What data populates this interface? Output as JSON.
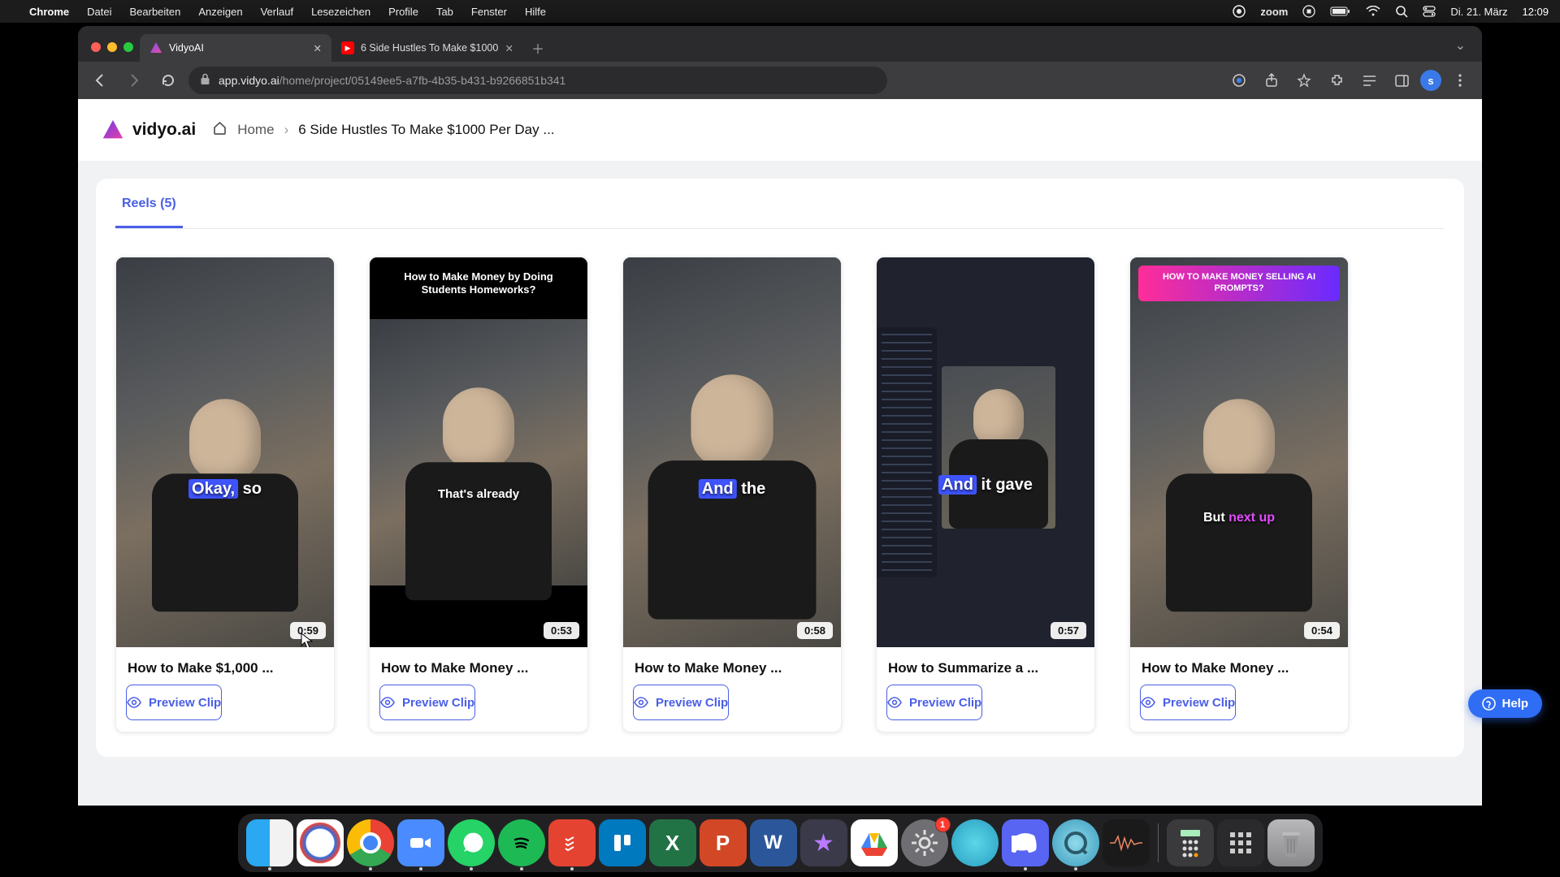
{
  "menubar": {
    "app": "Chrome",
    "items": [
      "Datei",
      "Bearbeiten",
      "Anzeigen",
      "Verlauf",
      "Lesezeichen",
      "Profile",
      "Tab",
      "Fenster",
      "Hilfe"
    ],
    "zoom": "zoom",
    "date": "Di. 21. März",
    "time": "12:09"
  },
  "browser": {
    "tabs": [
      {
        "title": "VidyoAI",
        "active": true
      },
      {
        "title": "6 Side Hustles To Make $1000",
        "active": false
      }
    ],
    "url_host": "app.vidyo.ai",
    "url_path": "/home/project/05149ee5-a7fb-4b35-b431-b9266851b341",
    "profile_initial": "s"
  },
  "page": {
    "brand": "vidyo.ai",
    "breadcrumb": {
      "home": "Home",
      "current": "6 Side Hustles To Make $1000 Per Day ..."
    },
    "tab_label": "Reels (5)",
    "preview_label": "Preview Clip",
    "help_label": "Help",
    "reels": [
      {
        "title": "How to Make $1,000 ...",
        "duration": "0:59",
        "caption_hl": "Okay,",
        "caption_rest": " so",
        "style": "blue"
      },
      {
        "title": "How to Make Money ...",
        "duration": "0:53",
        "banner": "How to Make Money by Doing Students Homeworks?",
        "caption_line": "That's already",
        "style": "blackbanner"
      },
      {
        "title": "How to Make Money ...",
        "duration": "0:58",
        "caption_hl": "And",
        "caption_rest": " the",
        "style": "blue"
      },
      {
        "title": "How to Summarize a ...",
        "duration": "0:57",
        "caption_hl": "And",
        "caption_rest": " it gave",
        "style": "pip"
      },
      {
        "title": "How to Make Money ...",
        "duration": "0:54",
        "banner": "HOW TO MAKE MONEY SELLING AI PROMPTS?",
        "caption_plain": "But ",
        "caption_color": "next up",
        "style": "gradbanner"
      }
    ]
  },
  "dock": {
    "settings_badge": "1",
    "icons": [
      "finder",
      "safari",
      "chrome",
      "zoom",
      "whatsapp",
      "spotify",
      "todoist",
      "trello",
      "excel",
      "ppt",
      "word",
      "imovie",
      "drive",
      "settings",
      "cyan",
      "discord",
      "qt",
      "audio"
    ],
    "right_icons": [
      "calc",
      "grid",
      "trash"
    ]
  }
}
